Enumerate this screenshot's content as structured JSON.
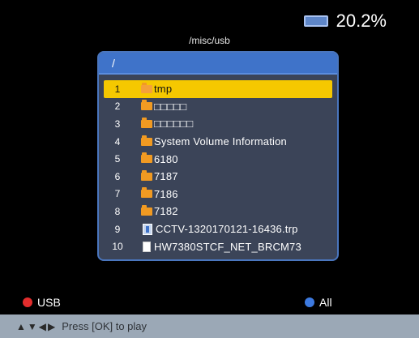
{
  "status": {
    "storage_icon": "storage-icon",
    "storage_percent": "20.2%"
  },
  "path": "/misc/usb",
  "browser": {
    "header": "/",
    "rows": [
      {
        "num": "1",
        "icon": "folder-icon",
        "label": "tmp",
        "selected": true
      },
      {
        "num": "2",
        "icon": "folder-icon",
        "label": "□□□□□",
        "selected": false
      },
      {
        "num": "3",
        "icon": "folder-icon",
        "label": "□□□□□□",
        "selected": false
      },
      {
        "num": "4",
        "icon": "folder-icon",
        "label": "System Volume Information",
        "selected": false
      },
      {
        "num": "5",
        "icon": "folder-icon",
        "label": "6180",
        "selected": false
      },
      {
        "num": "6",
        "icon": "folder-icon",
        "label": "7187",
        "selected": false
      },
      {
        "num": "7",
        "icon": "folder-icon",
        "label": "7186",
        "selected": false
      },
      {
        "num": "8",
        "icon": "folder-icon",
        "label": "7182",
        "selected": false
      },
      {
        "num": "9",
        "icon": "video-file-icon",
        "label": "CCTV-1320170121-16436.trp",
        "selected": false
      },
      {
        "num": "10",
        "icon": "file-icon",
        "label": "HW7380STCF_NET_BRCM73",
        "selected": false
      }
    ]
  },
  "footer": {
    "usb_label": "USB",
    "all_label": "All",
    "usb_color": "#e32d2d",
    "all_color": "#3d7ae0"
  },
  "hint": {
    "arrows": [
      "▲",
      "▼",
      "◀",
      "▶"
    ],
    "text": "Press [OK] to play"
  },
  "colors": {
    "selection": "#f5c800",
    "panel": "#3b4458",
    "header": "#3f73c9"
  }
}
